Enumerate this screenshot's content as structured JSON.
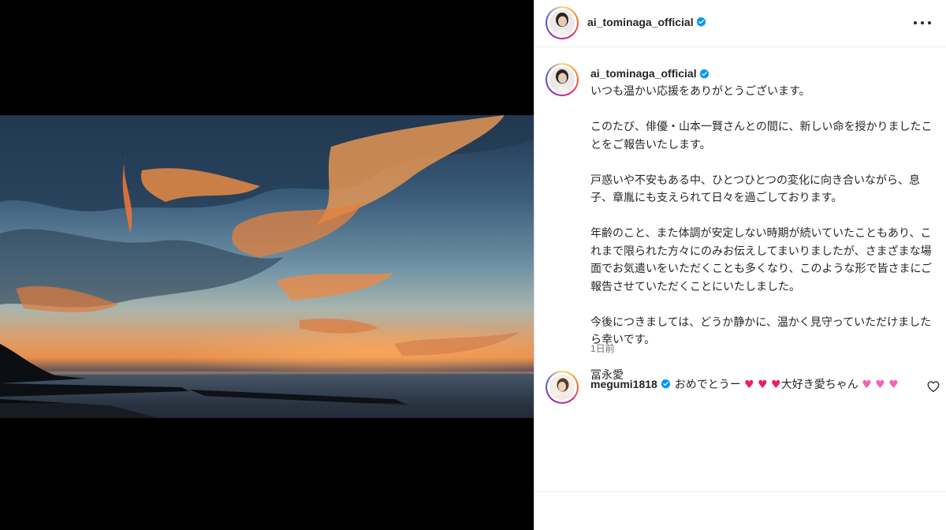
{
  "post": {
    "author": "ai_tominaga_official",
    "caption": "いつも温かい応援をありがとうございます。\n\nこのたび、俳優・山本一賢さんとの間に、新しい命を授かりましたことをご報告いたします。\n\n戸惑いや不安もある中、ひとつひとつの変化に向き合いながら、息子、章胤にも支えられて日々を過ごしております。\n\n年齢のこと、また体調が安定しない時期が続いていたこともあり、これまで限られた方々にのみお伝えしてまいりましたが、さまざまな場面でお気遣いをいただくことも多くなり、このような形で皆さまにご報告させていただくことにいたしました。\n\n今後につきましては、どうか静かに、温かく見守っていただけましたら幸いです。\n\n冨永愛",
    "time": "1日前"
  },
  "comment": {
    "user": "megumi1818",
    "text_before": "おめでとうー",
    "text_middle": "大好き愛ちゃん"
  },
  "colors": {
    "verified": "#0095f6",
    "heart": "#e91e63",
    "pink_heart": "#f065b4"
  },
  "icons": [
    "more-options-icon",
    "verified-badge-icon",
    "like-heart-icon"
  ]
}
